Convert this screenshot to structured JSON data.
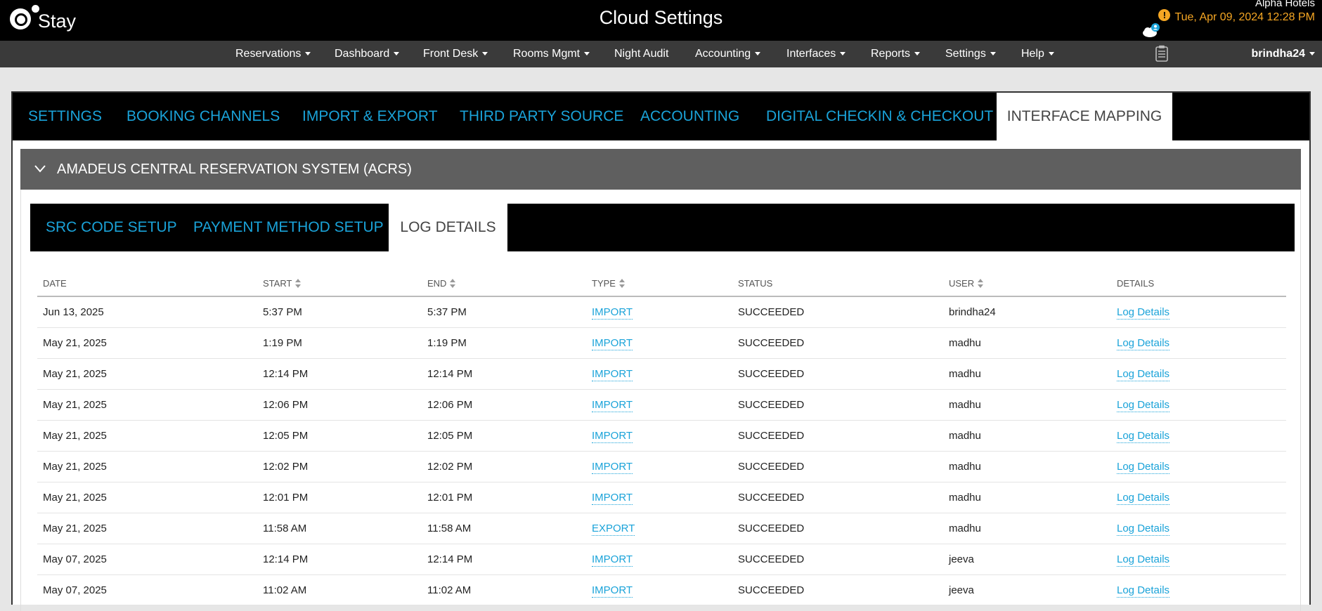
{
  "header": {
    "logo_text": "Stay",
    "app_title": "Cloud Settings",
    "hotel_name": "Alpha Hotels",
    "datetime": "Tue, Apr 09, 2024 12:28 PM",
    "alert_symbol": "!",
    "icons": [
      "alert-icon",
      "cloud-user-icon",
      "clipboard-icon"
    ]
  },
  "nav": {
    "items": [
      {
        "label": "Reservations",
        "dropdown": true
      },
      {
        "label": "Dashboard",
        "dropdown": true
      },
      {
        "label": "Front Desk",
        "dropdown": true
      },
      {
        "label": "Rooms Mgmt",
        "dropdown": true
      },
      {
        "label": "Night Audit",
        "dropdown": false
      },
      {
        "label": "Accounting",
        "dropdown": true
      },
      {
        "label": "Interfaces",
        "dropdown": true
      },
      {
        "label": "Reports",
        "dropdown": true
      },
      {
        "label": "Settings",
        "dropdown": true
      },
      {
        "label": "Help",
        "dropdown": true
      }
    ],
    "user": "brindha24"
  },
  "top_tabs": {
    "items": [
      "SETTINGS",
      "BOOKING CHANNELS",
      "IMPORT & EXPORT",
      "THIRD PARTY SOURCE",
      "ACCOUNTING",
      "DIGITAL CHECKIN & CHECKOUT",
      "INTERFACE MAPPING"
    ],
    "active": "INTERFACE MAPPING"
  },
  "accordion": {
    "title": "AMADEUS CENTRAL RESERVATION SYSTEM (ACRS)",
    "expanded": true
  },
  "sub_tabs": {
    "items": [
      "SRC CODE SETUP",
      "PAYMENT METHOD SETUP",
      "LOG DETAILS"
    ],
    "active": "LOG DETAILS"
  },
  "table": {
    "columns": [
      "DATE",
      "START",
      "END",
      "TYPE",
      "STATUS",
      "USER",
      "DETAILS"
    ],
    "sortable": [
      "START",
      "END",
      "TYPE",
      "USER"
    ],
    "rows": [
      {
        "date": "Jun 13, 2025",
        "start": "5:37 PM",
        "end": "5:37 PM",
        "type": "IMPORT",
        "status": "SUCCEEDED",
        "user": "brindha24",
        "details": "Log Details"
      },
      {
        "date": "May 21, 2025",
        "start": "1:19 PM",
        "end": "1:19 PM",
        "type": "IMPORT",
        "status": "SUCCEEDED",
        "user": "madhu",
        "details": "Log Details"
      },
      {
        "date": "May 21, 2025",
        "start": "12:14 PM",
        "end": "12:14 PM",
        "type": "IMPORT",
        "status": "SUCCEEDED",
        "user": "madhu",
        "details": "Log Details"
      },
      {
        "date": "May 21, 2025",
        "start": "12:06 PM",
        "end": "12:06 PM",
        "type": "IMPORT",
        "status": "SUCCEEDED",
        "user": "madhu",
        "details": "Log Details"
      },
      {
        "date": "May 21, 2025",
        "start": "12:05 PM",
        "end": "12:05 PM",
        "type": "IMPORT",
        "status": "SUCCEEDED",
        "user": "madhu",
        "details": "Log Details"
      },
      {
        "date": "May 21, 2025",
        "start": "12:02 PM",
        "end": "12:02 PM",
        "type": "IMPORT",
        "status": "SUCCEEDED",
        "user": "madhu",
        "details": "Log Details"
      },
      {
        "date": "May 21, 2025",
        "start": "12:01 PM",
        "end": "12:01 PM",
        "type": "IMPORT",
        "status": "SUCCEEDED",
        "user": "madhu",
        "details": "Log Details"
      },
      {
        "date": "May 21, 2025",
        "start": "11:58 AM",
        "end": "11:58 AM",
        "type": "EXPORT",
        "status": "SUCCEEDED",
        "user": "madhu",
        "details": "Log Details"
      },
      {
        "date": "May 07, 2025",
        "start": "12:14 PM",
        "end": "12:14 PM",
        "type": "IMPORT",
        "status": "SUCCEEDED",
        "user": "jeeva",
        "details": "Log Details"
      },
      {
        "date": "May 07, 2025",
        "start": "11:02 AM",
        "end": "11:02 AM",
        "type": "IMPORT",
        "status": "SUCCEEDED",
        "user": "jeeva",
        "details": "Log Details"
      }
    ]
  },
  "colors": {
    "topbar": "#000000",
    "navbar": "#3a3a3a",
    "tab_text": "#1aa3d9",
    "accordion_header": "#5f5f5f",
    "datetime": "#f5a623",
    "link": "#1aa3d9"
  }
}
